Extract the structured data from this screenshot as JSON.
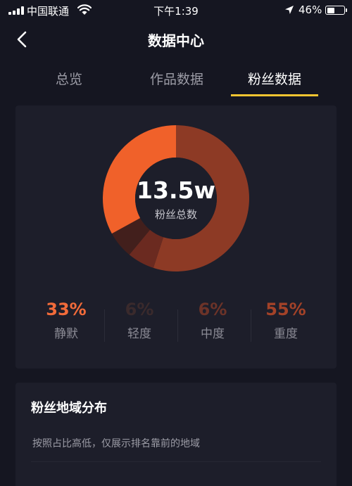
{
  "status_bar": {
    "carrier": "中国联通",
    "time": "下午1:39",
    "battery_percent": "46%",
    "battery_level": 0.46,
    "icons": [
      "signal-icon",
      "wifi-icon",
      "location-arrow-icon",
      "battery-icon"
    ]
  },
  "header": {
    "title": "数据中心",
    "back_icon": "chevron-left-icon"
  },
  "tabs": [
    {
      "label": "总览",
      "active": false
    },
    {
      "label": "作品数据",
      "active": false
    },
    {
      "label": "粉丝数据",
      "active": true
    }
  ],
  "accent_color": "#f5c531",
  "fans": {
    "total_value": "13.5w",
    "total_label": "粉丝总数",
    "segments": [
      {
        "label": "静默",
        "percent": 33,
        "percent_text": "33%",
        "color": "#f0612a",
        "text_color": "#f26b3a"
      },
      {
        "label": "轻度",
        "percent": 6,
        "percent_text": "6%",
        "color": "#421f1c",
        "text_color": "#3a2a2c"
      },
      {
        "label": "中度",
        "percent": 6,
        "percent_text": "6%",
        "color": "#6b2a20",
        "text_color": "#6c3328"
      },
      {
        "label": "重度",
        "percent": 55,
        "percent_text": "55%",
        "color": "#8d3a25",
        "text_color": "#a34228"
      }
    ]
  },
  "region": {
    "title": "粉丝地域分布",
    "description": "按照占比高低，仅展示排名靠前的地域"
  }
}
